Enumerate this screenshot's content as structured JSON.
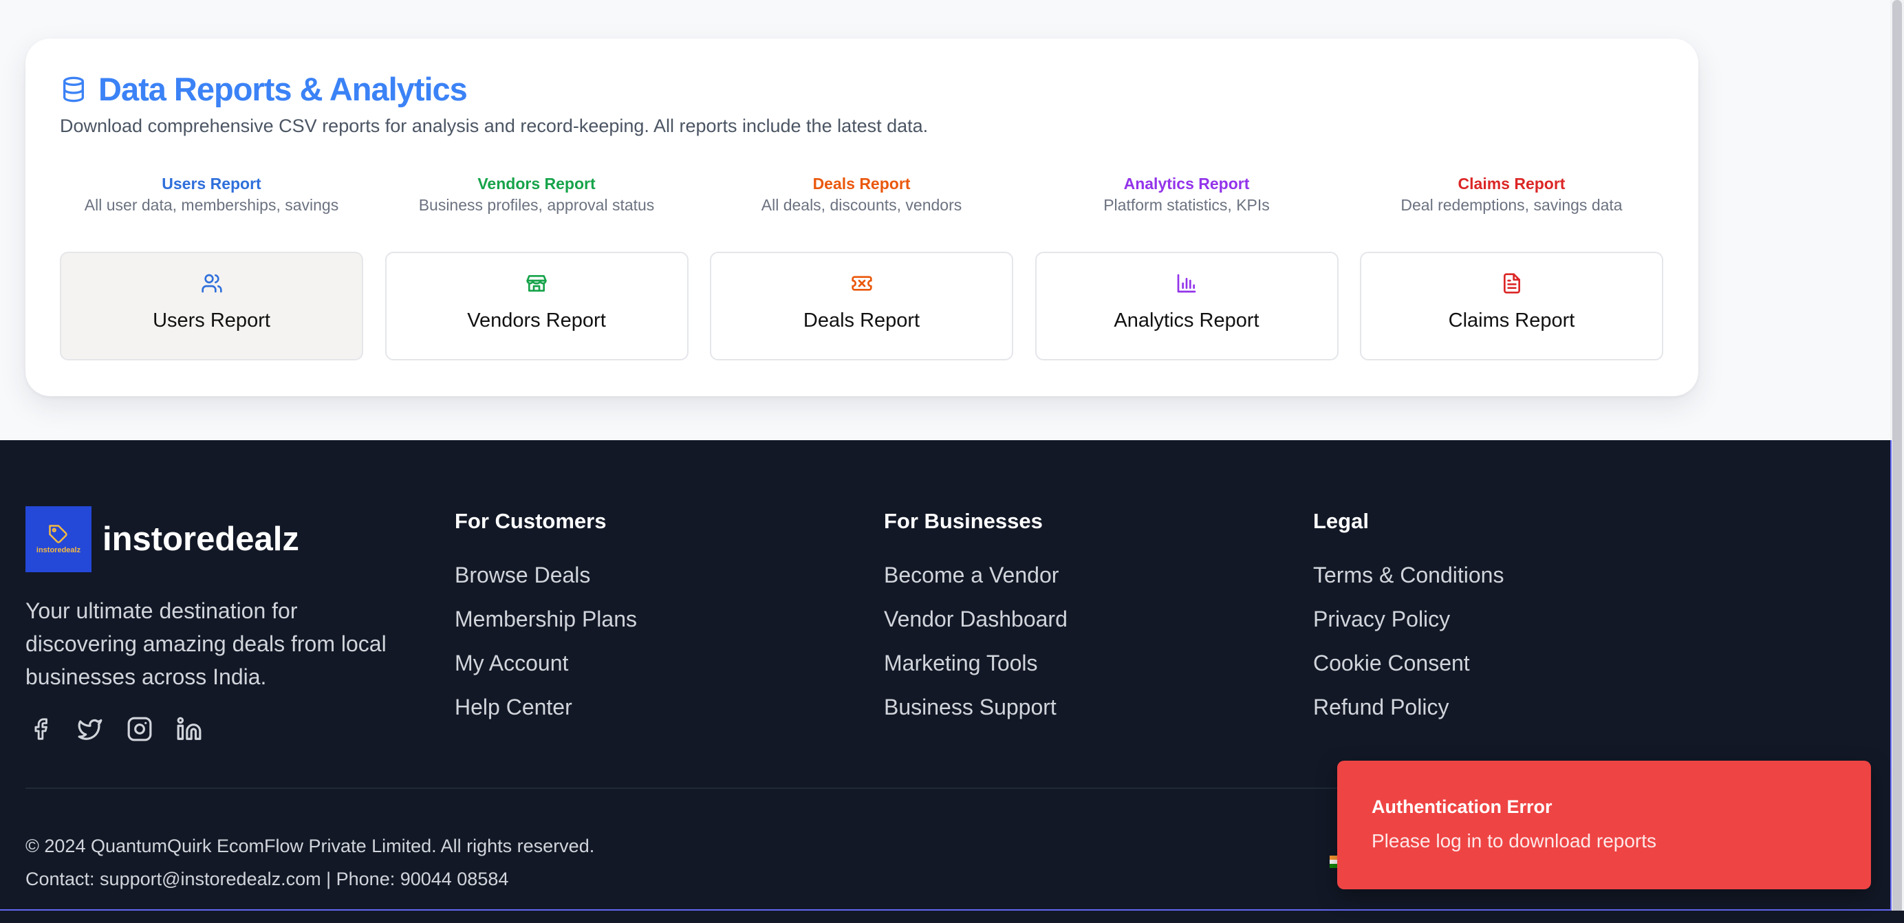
{
  "reports_section": {
    "title": "Data Reports & Analytics",
    "title_icon": "database-icon",
    "subtitle": "Download comprehensive CSV reports for analysis and record-keeping. All reports include the latest data.",
    "reports": [
      {
        "title": "Users Report",
        "description": "All user data, memberships, savings",
        "button_label": "Users Report",
        "color": "#2f6fdb",
        "icon": "users-icon"
      },
      {
        "title": "Vendors Report",
        "description": "Business profiles, approval status",
        "button_label": "Vendors Report",
        "color": "#16a34a",
        "icon": "store-icon"
      },
      {
        "title": "Deals Report",
        "description": "All deals, discounts, vendors",
        "button_label": "Deals Report",
        "color": "#ea580c",
        "icon": "ticket-icon"
      },
      {
        "title": "Analytics Report",
        "description": "Platform statistics, KPIs",
        "button_label": "Analytics Report",
        "color": "#9333ea",
        "icon": "bar-chart-icon"
      },
      {
        "title": "Claims Report",
        "description": "Deal redemptions, savings data",
        "button_label": "Claims Report",
        "color": "#dc2626",
        "icon": "file-text-icon"
      }
    ]
  },
  "footer": {
    "brand": {
      "name": "instoredealz",
      "logo_text": "instoredealz",
      "tagline": "Your ultimate destination for discovering amazing deals from local businesses across India."
    },
    "social": [
      "facebook-icon",
      "twitter-icon",
      "instagram-icon",
      "linkedin-icon"
    ],
    "columns": [
      {
        "title": "For Customers",
        "links": [
          "Browse Deals",
          "Membership Plans",
          "My Account",
          "Help Center"
        ]
      },
      {
        "title": "For Businesses",
        "links": [
          "Become a Vendor",
          "Vendor Dashboard",
          "Marketing Tools",
          "Business Support"
        ]
      },
      {
        "title": "Legal",
        "links": [
          "Terms & Conditions",
          "Privacy Policy",
          "Cookie Consent",
          "Refund Policy"
        ]
      }
    ],
    "copyright": "© 2024 QuantumQuirk EcomFlow Private Limited. All rights reserved.",
    "contact": "Contact: support@instoredealz.com | Phone: 90044 08584"
  },
  "toast": {
    "title": "Authentication Error",
    "message": "Please log in to download reports",
    "color": "#ef4444"
  }
}
